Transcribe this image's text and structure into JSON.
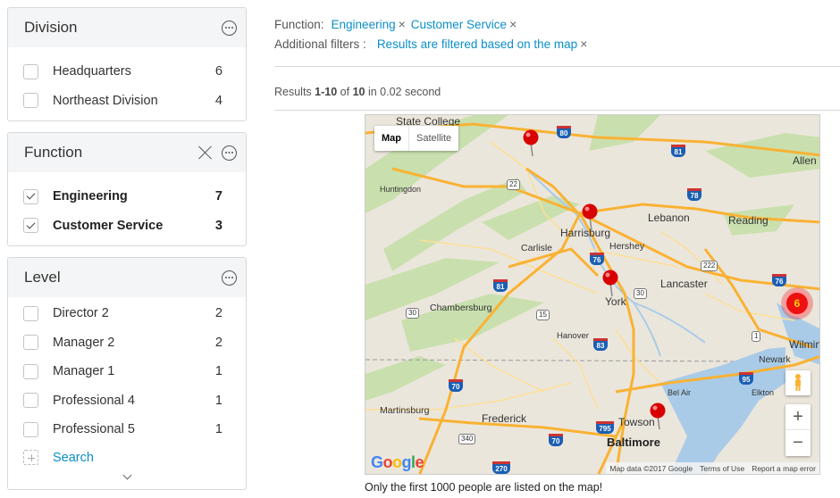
{
  "facets": {
    "division": {
      "title": "Division",
      "items": [
        {
          "label": "Headquarters",
          "count": "6"
        },
        {
          "label": "Northeast Division",
          "count": "4"
        }
      ]
    },
    "function": {
      "title": "Function",
      "items": [
        {
          "label": "Engineering",
          "count": "7",
          "checked": true
        },
        {
          "label": "Customer Service",
          "count": "3",
          "checked": true
        }
      ]
    },
    "level": {
      "title": "Level",
      "items": [
        {
          "label": "Director 2",
          "count": "2"
        },
        {
          "label": "Manager 2",
          "count": "2"
        },
        {
          "label": "Manager 1",
          "count": "1"
        },
        {
          "label": "Professional 4",
          "count": "1"
        },
        {
          "label": "Professional 5",
          "count": "1"
        }
      ],
      "search_label": "Search"
    }
  },
  "filters": {
    "function_key": "Function:",
    "function_chips": [
      "Engineering",
      "Customer Service"
    ],
    "additional_key": "Additional filters :",
    "additional_chip": "Results are filtered based on the map",
    "remove_glyph": "×"
  },
  "results": {
    "prefix": "Results ",
    "range": "1-10",
    "of": " of ",
    "total": "10",
    "suffix": " in 0.02 second"
  },
  "map": {
    "type_buttons": {
      "map": "Map",
      "satellite": "Satellite"
    },
    "cluster_count": "6",
    "zoom_in": "+",
    "zoom_out": "−",
    "logo": [
      "G",
      "o",
      "o",
      "g",
      "l",
      "e"
    ],
    "logo_colors": [
      "#4285f4",
      "#ea4335",
      "#fbbc05",
      "#4285f4",
      "#34a853",
      "#ea4335"
    ],
    "attribution": {
      "data": "Map data ©2017 Google",
      "terms": "Terms of Use",
      "report": "Report a map error"
    },
    "labels": {
      "state_college": "State College",
      "allentown": "Allen",
      "huntingdon": "Huntingdon",
      "harrisburg": "Harrisburg",
      "lebanon": "Lebanon",
      "reading": "Reading",
      "carlisle": "Carlisle",
      "hershey": "Hershey",
      "lancaster": "Lancaster",
      "york": "York",
      "chambersburg": "Chambersburg",
      "hanover": "Hanover",
      "wilmington": "Wilmin",
      "newark": "Newark",
      "elkton": "Elkton",
      "bel_air": "Bel Air",
      "martinsburg": "Martinsburg",
      "frederick": "Frederick",
      "towson": "Towson",
      "baltimore": "Baltimore"
    },
    "shields": {
      "i80": "80",
      "r22": "22",
      "i81": "81",
      "i78": "78",
      "r222": "222",
      "i76": "76",
      "r30a": "30",
      "r30b": "30",
      "r15": "15",
      "i83": "83",
      "i70": "70",
      "r1": "1",
      "i95": "95",
      "r340": "340",
      "i795": "795",
      "i70b": "70",
      "i270": "270",
      "i81b": "81",
      "i76b": "76"
    },
    "colors": {
      "pin": "#d80000",
      "land": "#ebe6dc",
      "green": "#c5dfa9",
      "water": "#a9cbe8",
      "highway": "#f9b233",
      "road": "#fddf95"
    }
  },
  "map_note": "Only the first 1000 people are listed on the map!"
}
